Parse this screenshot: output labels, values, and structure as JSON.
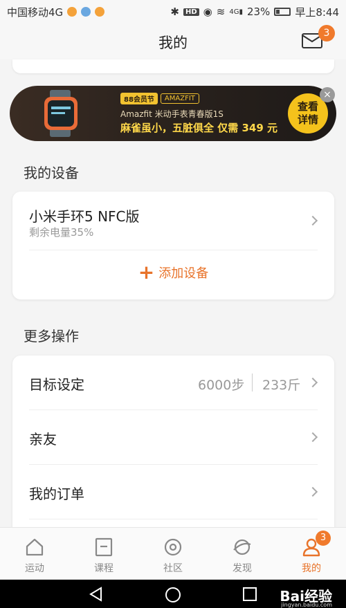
{
  "status_bar": {
    "carrier": "中国移动4G",
    "battery": "23%",
    "time": "早上8:44",
    "hd_label": "HD",
    "network": "4G"
  },
  "header": {
    "title": "我的",
    "mail_badge": "3"
  },
  "banner": {
    "tag_primary": "88会员节",
    "tag_brand": "AMAZFIT",
    "line1": "Amazfit 米动手表青春版1S",
    "line2": "麻雀虽小，五脏俱全 仅需 349 元",
    "button": "查看详情",
    "close": "×"
  },
  "devices": {
    "section_title": "我的设备",
    "device_name": "小米手环5 NFC版",
    "device_status": "剩余电量35%",
    "add_label": "添加设备"
  },
  "more": {
    "section_title": "更多操作",
    "goal_label": "目标设定",
    "goal_steps": "6000步",
    "goal_weight": "233斤",
    "friends_label": "亲友",
    "orders_label": "我的订单"
  },
  "tabs": [
    {
      "label": "运动",
      "icon": "home-icon"
    },
    {
      "label": "课程",
      "icon": "course-icon"
    },
    {
      "label": "社区",
      "icon": "community-icon"
    },
    {
      "label": "发现",
      "icon": "discover-icon"
    },
    {
      "label": "我的",
      "icon": "profile-icon",
      "badge": "3"
    }
  ],
  "watermark": {
    "brand": "Bai经验",
    "url": "jingyan.baidu.com"
  },
  "colors": {
    "accent": "#e8732a",
    "badge": "#f07a2c",
    "banner_button": "#f4c21c"
  }
}
